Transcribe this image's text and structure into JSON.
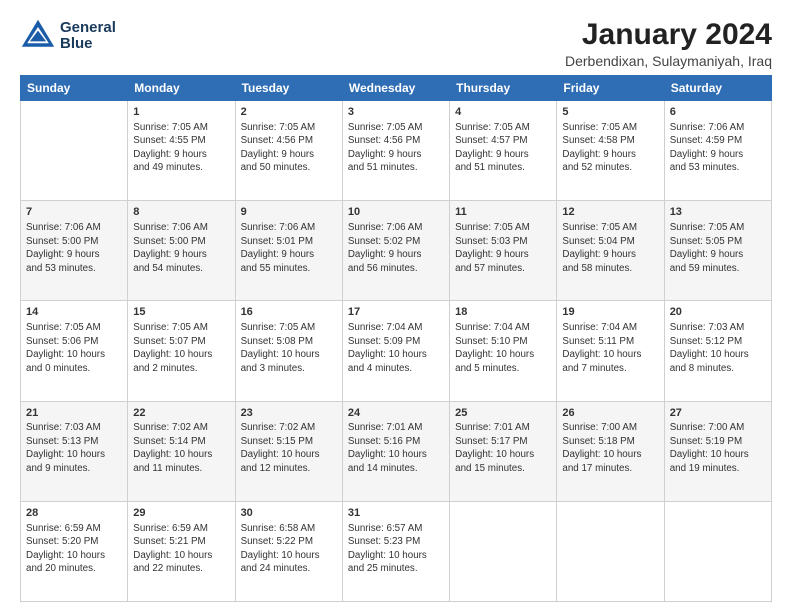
{
  "header": {
    "logo_line1": "General",
    "logo_line2": "Blue",
    "title": "January 2024",
    "subtitle": "Derbendixan, Sulaymaniyah, Iraq"
  },
  "columns": [
    "Sunday",
    "Monday",
    "Tuesday",
    "Wednesday",
    "Thursday",
    "Friday",
    "Saturday"
  ],
  "weeks": [
    [
      {
        "day": "",
        "info": ""
      },
      {
        "day": "1",
        "info": "Sunrise: 7:05 AM\nSunset: 4:55 PM\nDaylight: 9 hours\nand 49 minutes."
      },
      {
        "day": "2",
        "info": "Sunrise: 7:05 AM\nSunset: 4:56 PM\nDaylight: 9 hours\nand 50 minutes."
      },
      {
        "day": "3",
        "info": "Sunrise: 7:05 AM\nSunset: 4:56 PM\nDaylight: 9 hours\nand 51 minutes."
      },
      {
        "day": "4",
        "info": "Sunrise: 7:05 AM\nSunset: 4:57 PM\nDaylight: 9 hours\nand 51 minutes."
      },
      {
        "day": "5",
        "info": "Sunrise: 7:05 AM\nSunset: 4:58 PM\nDaylight: 9 hours\nand 52 minutes."
      },
      {
        "day": "6",
        "info": "Sunrise: 7:06 AM\nSunset: 4:59 PM\nDaylight: 9 hours\nand 53 minutes."
      }
    ],
    [
      {
        "day": "7",
        "info": "Sunrise: 7:06 AM\nSunset: 5:00 PM\nDaylight: 9 hours\nand 53 minutes."
      },
      {
        "day": "8",
        "info": "Sunrise: 7:06 AM\nSunset: 5:00 PM\nDaylight: 9 hours\nand 54 minutes."
      },
      {
        "day": "9",
        "info": "Sunrise: 7:06 AM\nSunset: 5:01 PM\nDaylight: 9 hours\nand 55 minutes."
      },
      {
        "day": "10",
        "info": "Sunrise: 7:06 AM\nSunset: 5:02 PM\nDaylight: 9 hours\nand 56 minutes."
      },
      {
        "day": "11",
        "info": "Sunrise: 7:05 AM\nSunset: 5:03 PM\nDaylight: 9 hours\nand 57 minutes."
      },
      {
        "day": "12",
        "info": "Sunrise: 7:05 AM\nSunset: 5:04 PM\nDaylight: 9 hours\nand 58 minutes."
      },
      {
        "day": "13",
        "info": "Sunrise: 7:05 AM\nSunset: 5:05 PM\nDaylight: 9 hours\nand 59 minutes."
      }
    ],
    [
      {
        "day": "14",
        "info": "Sunrise: 7:05 AM\nSunset: 5:06 PM\nDaylight: 10 hours\nand 0 minutes."
      },
      {
        "day": "15",
        "info": "Sunrise: 7:05 AM\nSunset: 5:07 PM\nDaylight: 10 hours\nand 2 minutes."
      },
      {
        "day": "16",
        "info": "Sunrise: 7:05 AM\nSunset: 5:08 PM\nDaylight: 10 hours\nand 3 minutes."
      },
      {
        "day": "17",
        "info": "Sunrise: 7:04 AM\nSunset: 5:09 PM\nDaylight: 10 hours\nand 4 minutes."
      },
      {
        "day": "18",
        "info": "Sunrise: 7:04 AM\nSunset: 5:10 PM\nDaylight: 10 hours\nand 5 minutes."
      },
      {
        "day": "19",
        "info": "Sunrise: 7:04 AM\nSunset: 5:11 PM\nDaylight: 10 hours\nand 7 minutes."
      },
      {
        "day": "20",
        "info": "Sunrise: 7:03 AM\nSunset: 5:12 PM\nDaylight: 10 hours\nand 8 minutes."
      }
    ],
    [
      {
        "day": "21",
        "info": "Sunrise: 7:03 AM\nSunset: 5:13 PM\nDaylight: 10 hours\nand 9 minutes."
      },
      {
        "day": "22",
        "info": "Sunrise: 7:02 AM\nSunset: 5:14 PM\nDaylight: 10 hours\nand 11 minutes."
      },
      {
        "day": "23",
        "info": "Sunrise: 7:02 AM\nSunset: 5:15 PM\nDaylight: 10 hours\nand 12 minutes."
      },
      {
        "day": "24",
        "info": "Sunrise: 7:01 AM\nSunset: 5:16 PM\nDaylight: 10 hours\nand 14 minutes."
      },
      {
        "day": "25",
        "info": "Sunrise: 7:01 AM\nSunset: 5:17 PM\nDaylight: 10 hours\nand 15 minutes."
      },
      {
        "day": "26",
        "info": "Sunrise: 7:00 AM\nSunset: 5:18 PM\nDaylight: 10 hours\nand 17 minutes."
      },
      {
        "day": "27",
        "info": "Sunrise: 7:00 AM\nSunset: 5:19 PM\nDaylight: 10 hours\nand 19 minutes."
      }
    ],
    [
      {
        "day": "28",
        "info": "Sunrise: 6:59 AM\nSunset: 5:20 PM\nDaylight: 10 hours\nand 20 minutes."
      },
      {
        "day": "29",
        "info": "Sunrise: 6:59 AM\nSunset: 5:21 PM\nDaylight: 10 hours\nand 22 minutes."
      },
      {
        "day": "30",
        "info": "Sunrise: 6:58 AM\nSunset: 5:22 PM\nDaylight: 10 hours\nand 24 minutes."
      },
      {
        "day": "31",
        "info": "Sunrise: 6:57 AM\nSunset: 5:23 PM\nDaylight: 10 hours\nand 25 minutes."
      },
      {
        "day": "",
        "info": ""
      },
      {
        "day": "",
        "info": ""
      },
      {
        "day": "",
        "info": ""
      }
    ]
  ]
}
